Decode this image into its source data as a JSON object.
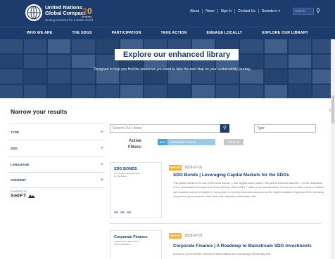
{
  "header": {
    "brand_line1": "United Nations",
    "brand_line2": "Global Compact",
    "tagline": "Uniting business for a better world",
    "badge": "20 YEARS",
    "top_links": [
      "About",
      "News",
      "Sign In",
      "Contact Us",
      "Sounds in ▾"
    ],
    "search_placeholder": "Search"
  },
  "main_nav": [
    "WHO WE ARE",
    "THE SDGS",
    "PARTICIPATION",
    "TAKE ACTION",
    "ENGAGE LOCALLY",
    "EXPLORE OUR LIBRARY"
  ],
  "hero": {
    "title": "Explore our enhanced library",
    "subtitle": "Designed to help you find the resources you need to take the next step on your sustainability journey."
  },
  "sidebar": {
    "title": "Narrow your results",
    "filters": [
      {
        "label": "TYPE",
        "icon": "plus"
      },
      {
        "label": "SDG",
        "icon": "plus"
      },
      {
        "label": "LANGUAGE",
        "icon": "plus"
      },
      {
        "label": "CONTENT",
        "icon": "plus"
      }
    ],
    "powered_by": "POWERED BY",
    "shift": "SHIFT"
  },
  "library_search": {
    "placeholder": "Search Our Library",
    "sort_value": "Type"
  },
  "active_filters": {
    "label": "Active Filters:",
    "chip_tag": "SDG",
    "chip_value": "Sustainable Finance",
    "clear_all": "Clear All"
  },
  "results": [
    {
      "thumb_title": "SDG BONDS",
      "thumb_subtitle": "Leveraging Capital Markets for the SDGs",
      "type": "REPORT",
      "date": "2019-07-01",
      "title": "SDG Bonds | Leveraging Capital Markets for the SDGs",
      "description": "This guide explains the role of the bond market — the largest asset class in the global financial markets — in the realization of the Sustainable Development Goals (SDGs). With US$ 4.7 trillion of annual issuance, bonds can provide a simple, reliable and scalable source of capital for companies to develop business solutions for the implementation of Agenda 2030, including companies, governments, cities and multi-national partnerships, with"
    },
    {
      "thumb_title": "Corporate Finance",
      "thumb_subtitle": "A Roadmap to Mainstream SDG Investments",
      "type": "REPORT",
      "date": "2019-07-01",
      "title": "Corporate Finance | A Roadmap to Mainstream SDG Investments",
      "description": "Investors, governments, and other stakeholders are increasingly demanding that"
    }
  ],
  "colors": {
    "navy": "#1d3c6e",
    "report_badge": "#f2b233",
    "chip_sdg": "#4aa3d6"
  }
}
